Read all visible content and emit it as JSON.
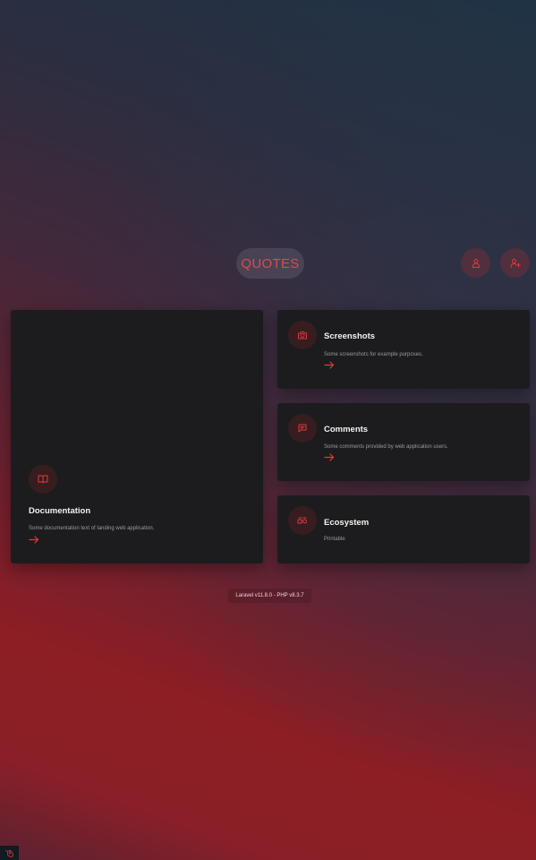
{
  "header": {
    "logo_text": "QUOTES",
    "login_icon": "user-icon",
    "register_icon": "user-plus-icon"
  },
  "cards": {
    "documentation": {
      "icon": "book-icon",
      "title": "Documentation",
      "text": "Some documentation text of landing web application."
    },
    "screenshots": {
      "icon": "camera-icon",
      "title": "Screenshots",
      "text": "Some screenshots for example purposes."
    },
    "comments": {
      "icon": "chat-icon",
      "title": "Comments",
      "text": "Some comments provided by web application users."
    },
    "ecosystem": {
      "icon": "ecosystem-icon",
      "title": "Ecosystem",
      "text": "Printable"
    }
  },
  "footer": {
    "version_text": "Laravel v11.8.0 - PHP v8.3.7"
  },
  "colors": {
    "accent": "#e0393c",
    "card_bg": "#1c1c1e",
    "title": "#f2f2f2",
    "muted": "#9a9aa0"
  }
}
